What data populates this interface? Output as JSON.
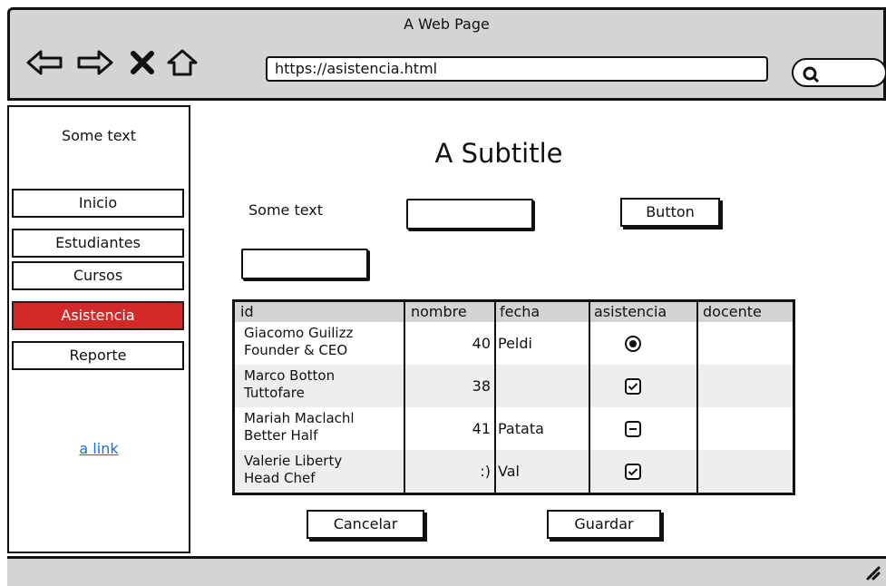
{
  "window": {
    "title": "A Web Page"
  },
  "browser": {
    "url": "https://asistencia.html",
    "icons": [
      "back-arrow-icon",
      "forward-arrow-icon",
      "close-icon",
      "home-icon",
      "search-icon"
    ]
  },
  "sidebar": {
    "header_text": "Some text",
    "items": [
      {
        "label": "Inicio",
        "active": false
      },
      {
        "label": "Estudiantes",
        "active": false
      },
      {
        "label": "Cursos",
        "active": false
      },
      {
        "label": "Asistencia",
        "active": true
      },
      {
        "label": "Reporte",
        "active": false
      }
    ],
    "link": "a link",
    "active_color": "#d42929"
  },
  "main": {
    "subtitle": "A Subtitle",
    "label_text": "Some text",
    "button_label": "Button",
    "table": {
      "columns": [
        "id",
        "nombre",
        "fecha",
        "asistencia",
        "docente"
      ],
      "rows": [
        {
          "name": "Giacomo Guilizz",
          "role": "Founder & CEO",
          "nombre": "40",
          "fecha": "Peldi",
          "asistencia": "radio-selected"
        },
        {
          "name": "Marco Botton",
          "role": "Tuttofare",
          "nombre": "38",
          "fecha": "",
          "asistencia": "checkbox-checked"
        },
        {
          "name": "Mariah Maclachl",
          "role": "Better Half",
          "nombre": "41",
          "fecha": "Patata",
          "asistencia": "checkbox-indeterminate"
        },
        {
          "name": "Valerie Liberty",
          "role": "Head Chef",
          "nombre": ":)",
          "fecha": "Val",
          "asistencia": "checkbox-checked"
        }
      ]
    },
    "cancel_label": "Cancelar",
    "save_label": "Guardar"
  }
}
